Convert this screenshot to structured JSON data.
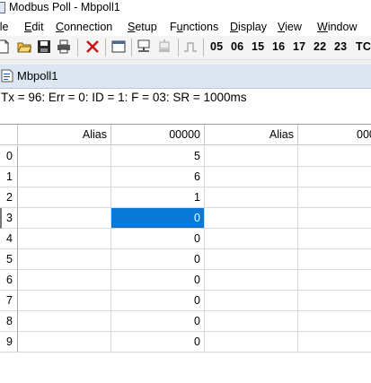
{
  "window": {
    "title": "Modbus Poll - Mbpoll1"
  },
  "menu": [
    {
      "label": "ile",
      "underline": ""
    },
    {
      "label": "Edit",
      "underline": "E"
    },
    {
      "label": "Connection",
      "underline": "C"
    },
    {
      "label": "Setup",
      "underline": "S"
    },
    {
      "label": "Functions",
      "underline": "u"
    },
    {
      "label": "Display",
      "underline": "D"
    },
    {
      "label": "View",
      "underline": "V"
    },
    {
      "label": "Window",
      "underline": "W"
    }
  ],
  "toolbar": {
    "function_codes": [
      "05",
      "06",
      "15",
      "16",
      "17",
      "22",
      "23",
      "TC"
    ]
  },
  "child_window": {
    "title": "Mbpoll1"
  },
  "status_line": "Tx = 96: Err = 0: ID = 1: F = 03: SR = 1000ms",
  "grid": {
    "columns": [
      "Alias",
      "00000",
      "Alias",
      "000"
    ],
    "rows": [
      "0",
      "1",
      "2",
      "3",
      "4",
      "5",
      "6",
      "7",
      "8",
      "9"
    ],
    "values": [
      "5",
      "6",
      "1",
      "0",
      "0",
      "0",
      "0",
      "0",
      "0",
      "0"
    ],
    "selected_row": 3
  },
  "colors": {
    "selection": "#0a78d7",
    "caption": "#dce6f1"
  }
}
